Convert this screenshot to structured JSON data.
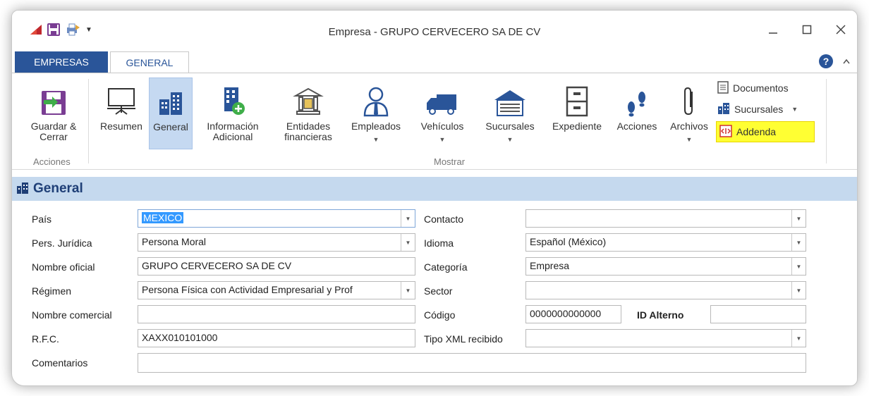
{
  "window": {
    "title": "Empresa - GRUPO CERVECERO SA DE CV",
    "minimize_icon": "minimize-icon",
    "maximize_icon": "maximize-icon",
    "close_icon": "close-icon"
  },
  "tabs": [
    {
      "label": "EMPRESAS"
    },
    {
      "label": "GENERAL"
    }
  ],
  "ribbon": {
    "acciones_group": "Acciones",
    "mostrar_group": "Mostrar",
    "buttons": {
      "guardar": "Guardar & Cerrar",
      "resumen": "Resumen",
      "general": "General",
      "informacion": "Información Adicional",
      "entidades": "Entidades financieras",
      "empleados": "Empleados",
      "vehiculos": "Vehículos",
      "sucursales": "Sucursales",
      "expediente": "Expediente",
      "acciones": "Acciones",
      "archivos": "Archivos"
    },
    "small": {
      "documentos": "Documentos",
      "sucursales": "Sucursales",
      "addenda": "Addenda"
    }
  },
  "section": {
    "title": "General"
  },
  "form": {
    "pais_label": "País",
    "pais_value": "MEXICO",
    "pers_label": "Pers. Jurídica",
    "pers_value": "Persona Moral",
    "nombre_oficial_label": "Nombre oficial",
    "nombre_oficial_value": "GRUPO CERVECERO SA DE CV",
    "regimen_label": "Régimen",
    "regimen_value": "Persona Física con Actividad Empresarial y Prof",
    "nombre_comercial_label": "Nombre comercial",
    "nombre_comercial_value": "",
    "rfc_label": "R.F.C.",
    "rfc_value": "XAXX010101000",
    "comentarios_label": "Comentarios",
    "comentarios_value": "",
    "contacto_label": "Contacto",
    "contacto_value": "",
    "idioma_label": "Idioma",
    "idioma_value": "Español (México)",
    "categoria_label": "Categoría",
    "categoria_value": "Empresa",
    "sector_label": "Sector",
    "sector_value": "",
    "codigo_label": "Código",
    "codigo_value": "0000000000000",
    "id_alterno_label": "ID Alterno",
    "id_alterno_value": "",
    "tipo_xml_label": "Tipo XML recibido",
    "tipo_xml_value": ""
  },
  "colors": {
    "accent": "#2a5599",
    "section_bg": "#c5d9ee",
    "highlight": "#ffff33"
  }
}
